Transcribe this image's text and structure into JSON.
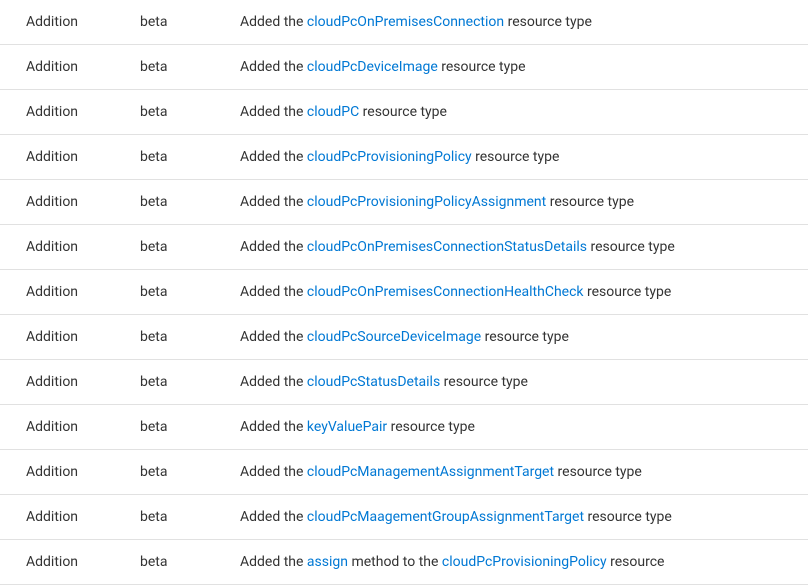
{
  "link_color": "#0078d4",
  "rows": [
    {
      "change": "Addition",
      "version": "beta",
      "desc_prefix": "Added the ",
      "links": [
        "cloudPcOnPremisesConnection"
      ],
      "desc_mid": [
        ""
      ],
      "desc_suffix": " resource type"
    },
    {
      "change": "Addition",
      "version": "beta",
      "desc_prefix": "Added the ",
      "links": [
        "cloudPcDeviceImage"
      ],
      "desc_mid": [
        ""
      ],
      "desc_suffix": " resource type"
    },
    {
      "change": "Addition",
      "version": "beta",
      "desc_prefix": "Added the ",
      "links": [
        "cloudPC"
      ],
      "desc_mid": [
        ""
      ],
      "desc_suffix": " resource type"
    },
    {
      "change": "Addition",
      "version": "beta",
      "desc_prefix": "Added the ",
      "links": [
        "cloudPcProvisioningPolicy"
      ],
      "desc_mid": [
        ""
      ],
      "desc_suffix": " resource type"
    },
    {
      "change": "Addition",
      "version": "beta",
      "desc_prefix": "Added the ",
      "links": [
        "cloudPcProvisioningPolicyAssignment"
      ],
      "desc_mid": [
        ""
      ],
      "desc_suffix": " resource type"
    },
    {
      "change": "Addition",
      "version": "beta",
      "desc_prefix": "Added the ",
      "links": [
        "cloudPcOnPremisesConnectionStatusDetails"
      ],
      "desc_mid": [
        ""
      ],
      "desc_suffix": " resource type"
    },
    {
      "change": "Addition",
      "version": "beta",
      "desc_prefix": "Added the ",
      "links": [
        "cloudPcOnPremisesConnectionHealthCheck"
      ],
      "desc_mid": [
        ""
      ],
      "desc_suffix": " resource type"
    },
    {
      "change": "Addition",
      "version": "beta",
      "desc_prefix": "Added the ",
      "links": [
        "cloudPcSourceDeviceImage"
      ],
      "desc_mid": [
        ""
      ],
      "desc_suffix": " resource type"
    },
    {
      "change": "Addition",
      "version": "beta",
      "desc_prefix": "Added the ",
      "links": [
        "cloudPcStatusDetails"
      ],
      "desc_mid": [
        ""
      ],
      "desc_suffix": " resource type"
    },
    {
      "change": "Addition",
      "version": "beta",
      "desc_prefix": "Added the ",
      "links": [
        "keyValuePair"
      ],
      "desc_mid": [
        ""
      ],
      "desc_suffix": " resource type"
    },
    {
      "change": "Addition",
      "version": "beta",
      "desc_prefix": "Added the ",
      "links": [
        "cloudPcManagementAssignmentTarget"
      ],
      "desc_mid": [
        ""
      ],
      "desc_suffix": " resource type"
    },
    {
      "change": "Addition",
      "version": "beta",
      "desc_prefix": "Added the ",
      "links": [
        "cloudPcMaagementGroupAssignmentTarget"
      ],
      "desc_mid": [
        ""
      ],
      "desc_suffix": " resource type"
    },
    {
      "change": "Addition",
      "version": "beta",
      "desc_prefix": "Added the ",
      "links": [
        "assign",
        "cloudPcProvisioningPolicy"
      ],
      "desc_mid": [
        " method to the "
      ],
      "desc_suffix": " resource"
    }
  ]
}
